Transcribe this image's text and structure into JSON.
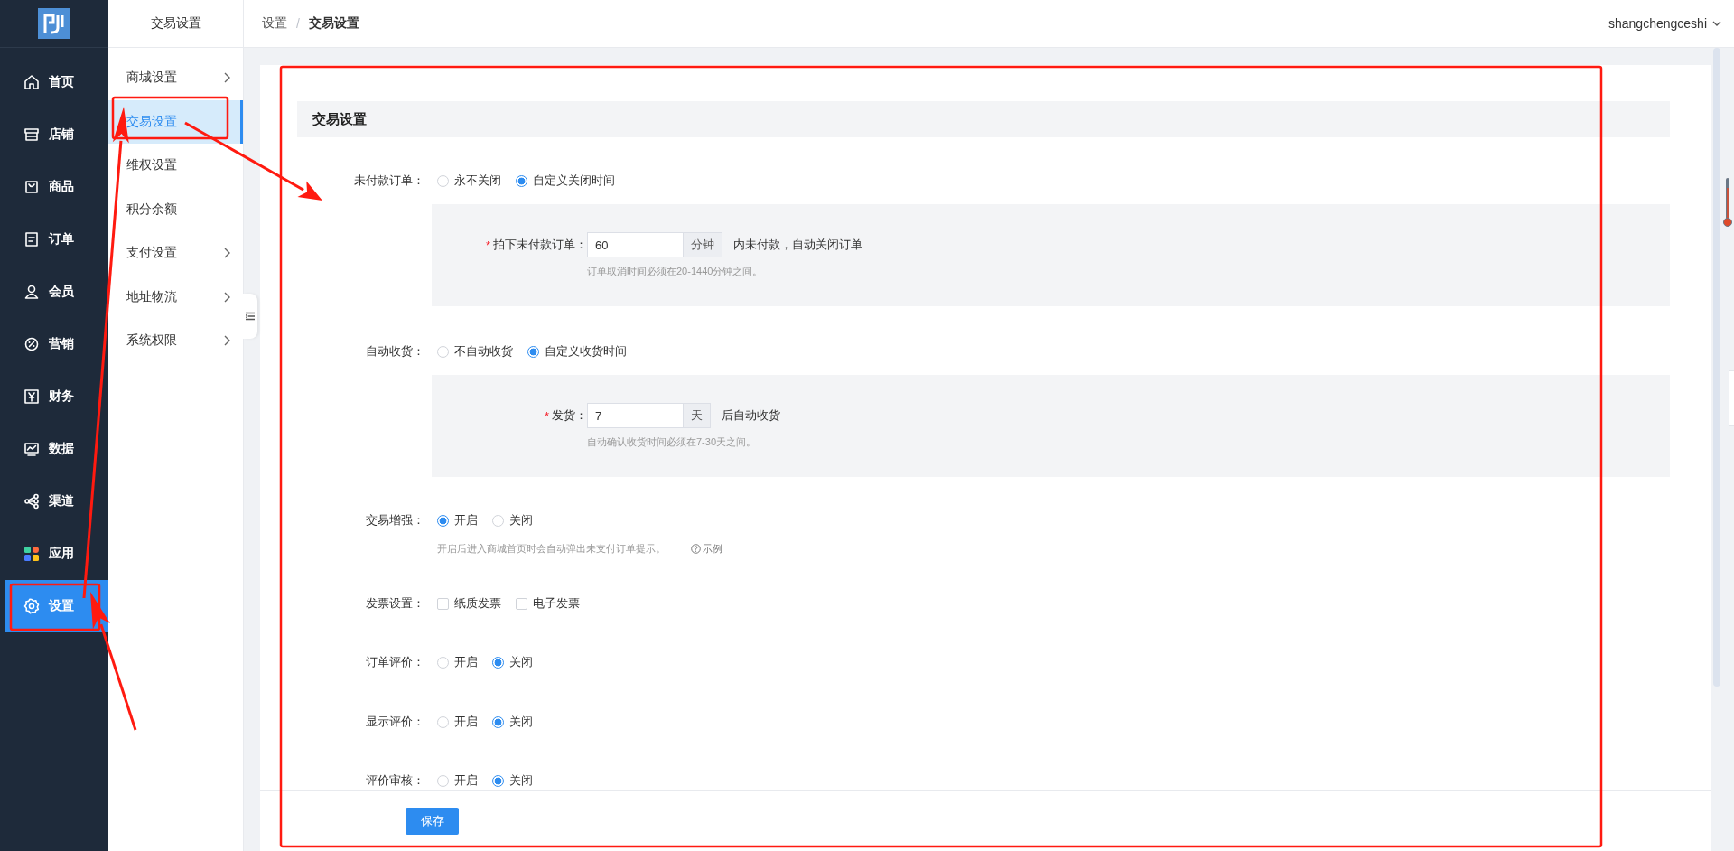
{
  "nav": [
    {
      "label": "首页",
      "selected": false
    },
    {
      "label": "店铺",
      "selected": false
    },
    {
      "label": "商品",
      "selected": false
    },
    {
      "label": "订单",
      "selected": false
    },
    {
      "label": "会员",
      "selected": false
    },
    {
      "label": "营销",
      "selected": false
    },
    {
      "label": "财务",
      "selected": false
    },
    {
      "label": "数据",
      "selected": false
    },
    {
      "label": "渠道",
      "selected": false
    },
    {
      "label": "应用",
      "selected": false
    },
    {
      "label": "设置",
      "selected": true
    }
  ],
  "subnav": {
    "title": "交易设置",
    "items": [
      {
        "label": "商城设置",
        "expandable": true,
        "selected": false
      },
      {
        "label": "交易设置",
        "expandable": false,
        "selected": true
      },
      {
        "label": "维权设置",
        "expandable": false,
        "selected": false
      },
      {
        "label": "积分余额",
        "expandable": false,
        "selected": false
      },
      {
        "label": "支付设置",
        "expandable": true,
        "selected": false
      },
      {
        "label": "地址物流",
        "expandable": true,
        "selected": false
      },
      {
        "label": "系统权限",
        "expandable": true,
        "selected": false
      }
    ]
  },
  "breadcrumb": [
    "设置",
    "交易设置"
  ],
  "breadcrumb_separator": "/",
  "user": "shangchengceshi",
  "section_title": "交易设置",
  "rows": [
    {
      "kind": "radio",
      "label": "未付款订单：",
      "options": [
        {
          "label": "永不关闭",
          "selected": false
        },
        {
          "label": "自定义关闭时间",
          "selected": true
        }
      ],
      "detail": {
        "required_mark": "*",
        "label": "拍下未付款订单：",
        "value": "60",
        "unit": "分钟",
        "suffix": "内未付款，自动关闭订单",
        "hint": "订单取消时间必须在20-1440分钟之间。"
      }
    },
    {
      "kind": "radio",
      "label": "自动收货：",
      "options": [
        {
          "label": "不自动收货",
          "selected": false
        },
        {
          "label": "自定义收货时间",
          "selected": true
        }
      ],
      "detail": {
        "required_mark": "*",
        "label": "发货：",
        "value": "7",
        "unit": "天",
        "suffix": "后自动收货",
        "hint": "自动确认收货时间必须在7-30天之间。"
      }
    },
    {
      "kind": "radio",
      "label": "交易增强：",
      "options": [
        {
          "label": "开启",
          "selected": true
        },
        {
          "label": "关闭",
          "selected": false
        }
      ],
      "hint": "开启后进入商城首页时会自动弹出未支付订单提示。",
      "link": "示例"
    },
    {
      "kind": "checkbox",
      "label": "发票设置：",
      "options": [
        {
          "label": "纸质发票",
          "checked": false
        },
        {
          "label": "电子发票",
          "checked": false
        }
      ]
    },
    {
      "kind": "radio",
      "label": "订单评价：",
      "options": [
        {
          "label": "开启",
          "selected": false
        },
        {
          "label": "关闭",
          "selected": true
        }
      ]
    },
    {
      "kind": "radio",
      "label": "显示评价：",
      "options": [
        {
          "label": "开启",
          "selected": false
        },
        {
          "label": "关闭",
          "selected": true
        }
      ]
    },
    {
      "kind": "radio",
      "label": "评价审核：",
      "options": [
        {
          "label": "开启",
          "selected": false
        },
        {
          "label": "关闭",
          "selected": true
        }
      ]
    }
  ],
  "save_button": "保存"
}
